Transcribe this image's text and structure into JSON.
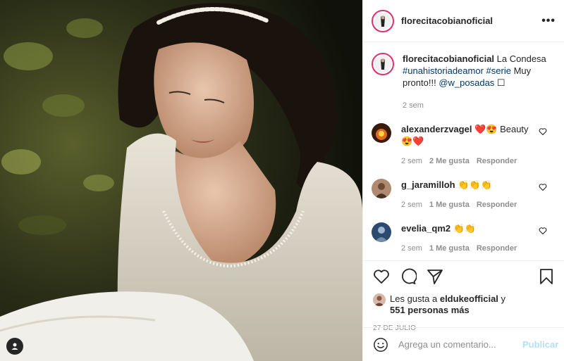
{
  "post": {
    "username": "florecitacobianoficial",
    "more_icon": "more-horizontal-icon"
  },
  "caption": {
    "username": "florecitacobianoficial",
    "text_1": "La Condesa",
    "hashtag_1": "#unahistoriadeamor",
    "hashtag_2": "#serie",
    "text_2": "Muy pronto!!!",
    "mention": "@w_posadas",
    "trailing_glyph": "☐",
    "time": "2 sem"
  },
  "comments": [
    {
      "username": "alexanderzvagel",
      "text": "❤️😍 Beauty 😍❤️",
      "time": "2 sem",
      "likes": "2 Me gusta",
      "reply": "Responder",
      "avatar_color": "#3a1a0a"
    },
    {
      "username": "g_jaramilloh",
      "text": "👏👏👏",
      "time": "2 sem",
      "likes": "1 Me gusta",
      "reply": "Responder",
      "avatar_color": "#b08a70"
    },
    {
      "username": "evelia_qm2",
      "text": "👏👏",
      "time": "2 sem",
      "likes": "1 Me gusta",
      "reply": "Responder",
      "avatar_color": "#2c4a6e"
    }
  ],
  "likes": {
    "prefix": "Les gusta a",
    "user": "eldukeofficial",
    "connector": "y",
    "count": "551 personas más"
  },
  "date": "27 DE JULIO",
  "add_comment": {
    "placeholder": "Agrega un comentario...",
    "publish": "Publicar"
  },
  "colors": {
    "story_ring": "#e1306c",
    "link": "#00376b",
    "secondary_text": "#8e8e8e",
    "publish_disabled": "#b2dffc"
  }
}
